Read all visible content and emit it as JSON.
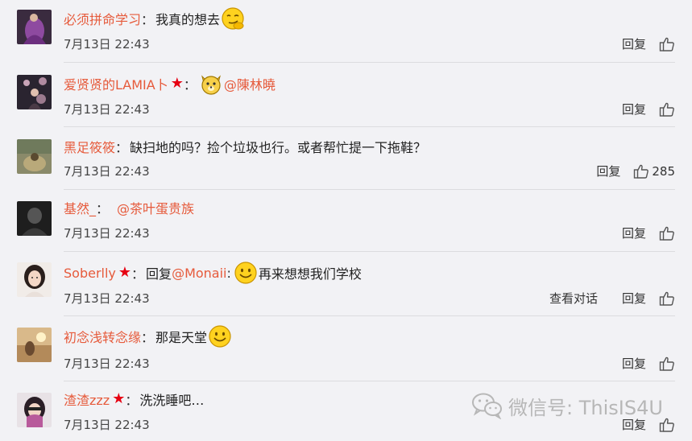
{
  "comments": [
    {
      "user": "必须拼命学习",
      "colon": "：",
      "text": "我真的想去",
      "time": "7月13日 22:43",
      "reply": "回复",
      "likes": ""
    },
    {
      "user": "爱贤贤的LAMIA卜",
      "colon": "：",
      "mention": "@陳林曉",
      "time": "7月13日 22:43",
      "reply": "回复",
      "likes": ""
    },
    {
      "user": "黑足筱筱",
      "colon": "：",
      "text": "缺扫地的吗？捡个垃圾也行。或者帮忙提一下拖鞋？",
      "time": "7月13日 22:43",
      "reply": "回复",
      "likes": "285"
    },
    {
      "user": "基然_",
      "colon": "：",
      "mention": "@茶叶蛋贵族",
      "time": "7月13日 22:43",
      "reply": "回复",
      "likes": ""
    },
    {
      "user": "Soberlly",
      "colon": "：",
      "prefix": "回复",
      "mention": "@Monaii",
      "colon2": ":",
      "text": "再来想想我们学校",
      "time": "7月13日 22:43",
      "view": "查看对话",
      "reply": "回复",
      "likes": ""
    },
    {
      "user": "初念浅转念缘",
      "colon": "：",
      "text": "那是天堂",
      "time": "7月13日 22:43",
      "reply": "回复",
      "likes": ""
    },
    {
      "user": "渣渣zzz",
      "colon": "：",
      "text": "洗洗睡吧…",
      "time": "7月13日 22:43",
      "reply": "回复",
      "likes": ""
    }
  ],
  "watermark": {
    "text": "微信号: ThisIS4U"
  },
  "colors": {
    "username": "#e65a3b",
    "star": "#e60012",
    "background": "#f2f2f5"
  }
}
